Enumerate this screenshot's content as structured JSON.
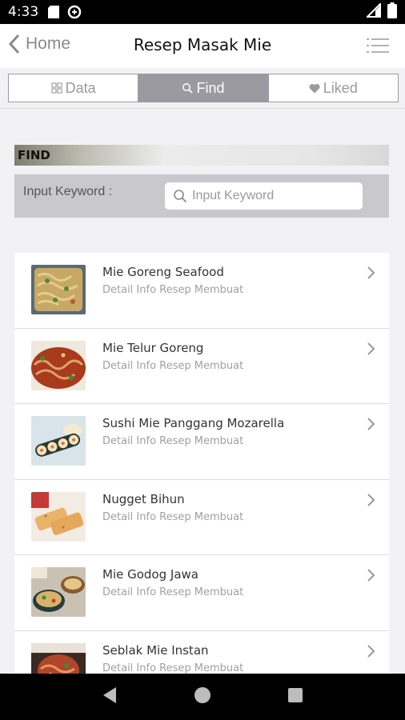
{
  "status": {
    "time": "4:33"
  },
  "nav": {
    "back_label": "Home",
    "title": "Resep Masak Mie"
  },
  "tabs": [
    {
      "label": "Data",
      "icon": "grid-icon",
      "active": false
    },
    {
      "label": "Find",
      "icon": "search-icon",
      "active": true
    },
    {
      "label": "Liked",
      "icon": "heart-icon",
      "active": false
    }
  ],
  "find": {
    "header": "FIND",
    "label": "Input Keyword :",
    "placeholder": "Input Keyword"
  },
  "recipes": [
    {
      "name": "Mie Goreng Seafood",
      "subtitle": "Detail Info Resep Membuat"
    },
    {
      "name": "Mie Telur Goreng",
      "subtitle": "Detail Info Resep Membuat"
    },
    {
      "name": "Sushi Mie Panggang Mozarella",
      "subtitle": "Detail Info Resep Membuat"
    },
    {
      "name": "Nugget Bihun",
      "subtitle": "Detail Info Resep Membuat"
    },
    {
      "name": "Mie Godog Jawa",
      "subtitle": "Detail Info Resep Membuat"
    },
    {
      "name": "Seblak Mie Instan",
      "subtitle": "Detail Info Resep Membuat"
    }
  ]
}
